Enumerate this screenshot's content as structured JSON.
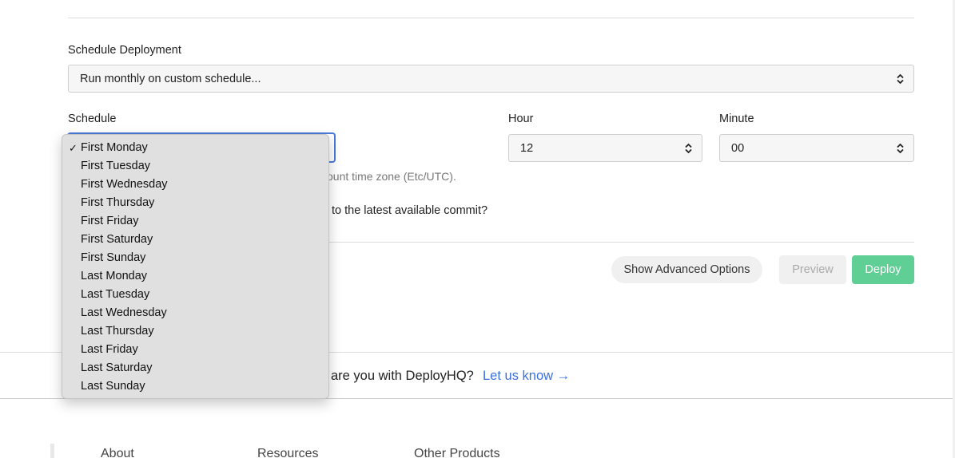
{
  "schedule_deployment": {
    "label": "Schedule Deployment",
    "selected": "Run monthly on custom schedule..."
  },
  "schedule": {
    "label": "Schedule",
    "help_text": "ount time zone (Etc/UTC).",
    "options": [
      "First Monday",
      "First Tuesday",
      "First Wednesday",
      "First Thursday",
      "First Friday",
      "First Saturday",
      "First Sunday",
      "Last Monday",
      "Last Tuesday",
      "Last Wednesday",
      "Last Thursday",
      "Last Friday",
      "Last Saturday",
      "Last Sunday"
    ],
    "selected_index": 0,
    "check_glyph": "✓"
  },
  "hour": {
    "label": "Hour",
    "value": "12"
  },
  "minute": {
    "label": "Minute",
    "value": "00"
  },
  "commit_question": "to the latest available commit?",
  "buttons": {
    "advanced": "Show Advanced Options",
    "preview": "Preview",
    "deploy": "Deploy"
  },
  "feedback": {
    "text": "are you with DeployHQ?",
    "link": "Let us know →"
  },
  "footer": {
    "columns": [
      "About",
      "Resources",
      "Other Products"
    ]
  },
  "icons": {
    "select_chevron": "chevron-up-down-icon",
    "check": "check-icon"
  },
  "colors": {
    "deploy_button": "#5fcf96",
    "link": "#3b6fe0",
    "focus_ring": "#4a7bd8"
  }
}
